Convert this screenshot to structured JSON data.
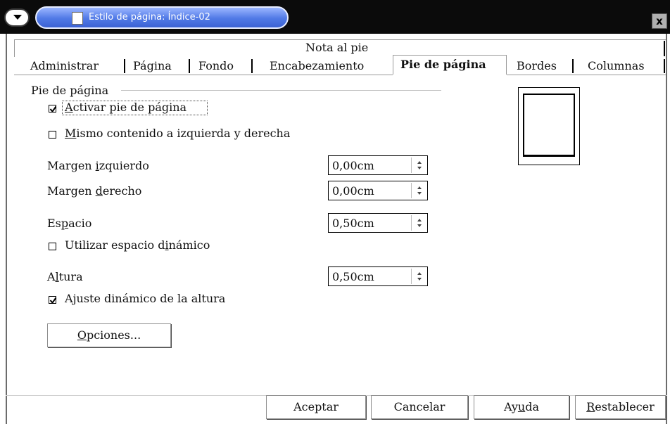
{
  "window": {
    "title": "Estilo de página: Índice-02",
    "close_label": "x"
  },
  "tabs": {
    "row1": [
      "Nota al pie"
    ],
    "row2": [
      "Administrar",
      "Página",
      "Fondo",
      "Encabezamiento",
      "Pie de página",
      "Bordes",
      "Columnas"
    ],
    "active": "Pie de página"
  },
  "section": {
    "title": "Pie de página"
  },
  "checkboxes": {
    "activar": {
      "pre": "",
      "u": "A",
      "post": "ctivar pie de página",
      "checked": true
    },
    "mismo": {
      "pre": "",
      "u": "M",
      "post": "ismo contenido a izquierda y derecha",
      "checked": false
    },
    "espacio_dinamico": {
      "pre": "Utilizar espacio d",
      "u": "i",
      "post": "námico",
      "checked": false
    },
    "ajuste": {
      "pre": "A",
      "u": "j",
      "post": "uste dinámico de la altura",
      "checked": true
    }
  },
  "fields": {
    "margen_izquierdo": {
      "pre": "Margen ",
      "u": "i",
      "post": "zquierdo",
      "value": "0,00cm"
    },
    "margen_derecho": {
      "pre": "Margen ",
      "u": "d",
      "post": "erecho",
      "value": "0,00cm"
    },
    "espacio": {
      "pre": "Es",
      "u": "p",
      "post": "acio",
      "value": "0,50cm"
    },
    "altura": {
      "pre": "A",
      "u": "l",
      "post": "tura",
      "value": "0,50cm"
    }
  },
  "buttons": {
    "opciones": {
      "u": "O",
      "post": "pciones..."
    },
    "aceptar": "Aceptar",
    "cancelar": "Cancelar",
    "ayuda": {
      "pre": "Ay",
      "u": "u",
      "post": "da"
    },
    "restablecer": {
      "u": "R",
      "post": "establecer"
    }
  }
}
